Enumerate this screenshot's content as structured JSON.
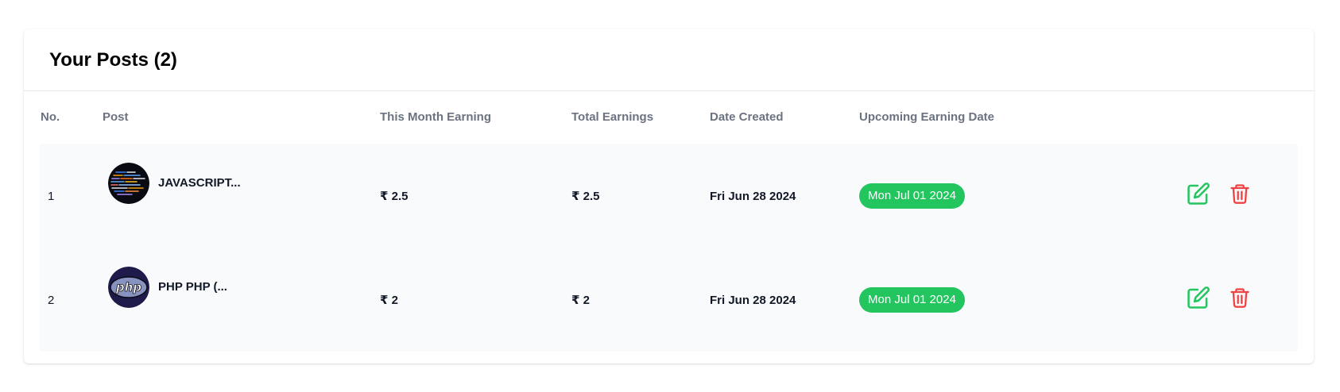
{
  "card": {
    "title": "Your Posts (2)"
  },
  "table": {
    "headers": [
      "No.",
      "Post",
      "This Month Earning",
      "Total Earnings",
      "Date Created",
      "Upcoming Earning Date"
    ],
    "rows": [
      {
        "no": "1",
        "post_title": "JAVASCRIPT...",
        "thumb_icon": "javascript-code-thumbnail",
        "month_earning": "₹ 2.5",
        "total_earnings": "₹ 2.5",
        "date_created": "Fri Jun 28 2024",
        "upcoming_date": "Mon Jul 01 2024"
      },
      {
        "no": "2",
        "post_title": "PHP PHP (...",
        "thumb_icon": "php-logo-thumbnail",
        "month_earning": "₹ 2",
        "total_earnings": "₹ 2",
        "date_created": "Fri Jun 28 2024",
        "upcoming_date": "Mon Jul 01 2024"
      }
    ]
  },
  "colors": {
    "badge_green": "#22c55e",
    "edit_green": "#22c55e",
    "delete_red": "#ef4444",
    "header_gray": "#6b7280",
    "row_bg": "#f9fafb"
  },
  "icons": {
    "edit": "edit-icon",
    "delete": "trash-icon"
  }
}
